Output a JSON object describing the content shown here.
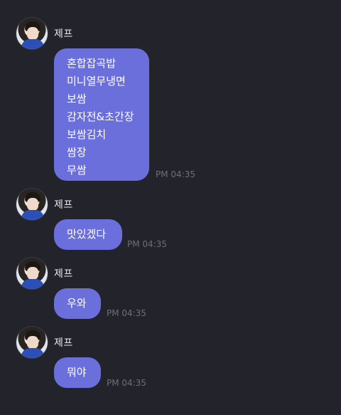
{
  "messages": [
    {
      "sender": "제프",
      "lines": [
        "혼합잡곡밥",
        "미니열무냉면",
        "보쌈",
        "감자전&초간장",
        "보쌈김치",
        "쌈장",
        "무쌈"
      ],
      "time": "PM 04:35"
    },
    {
      "sender": "제프",
      "lines": [
        "맛있겠다"
      ],
      "time": "PM 04:35"
    },
    {
      "sender": "제프",
      "lines": [
        "우와"
      ],
      "time": "PM 04:35"
    },
    {
      "sender": "제프",
      "lines": [
        "뭐야"
      ],
      "time": "PM 04:35"
    }
  ]
}
